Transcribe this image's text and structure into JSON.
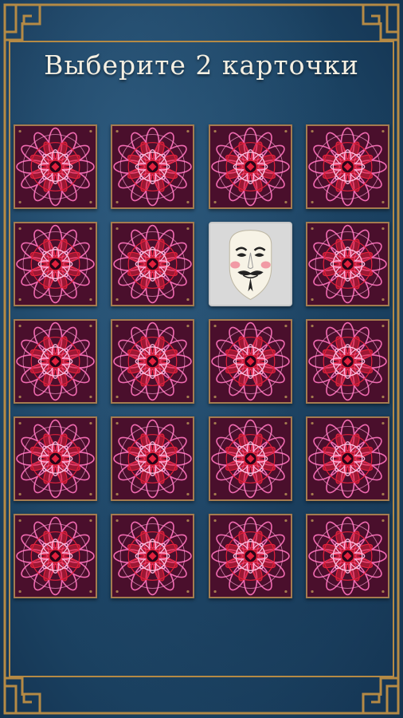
{
  "title": "Выберите 2 карточки",
  "colors": {
    "background": "#1d4666",
    "frame_gold": "#b58a45",
    "card_back": "#4a0f2c",
    "card_border": "#a57b4f",
    "pattern_pink": "#f06ab0",
    "pattern_red": "#e0203c",
    "revealed_bg": "#d9d9d9"
  },
  "board": {
    "rows": 5,
    "cols": 4,
    "cards": [
      {
        "state": "hidden"
      },
      {
        "state": "hidden"
      },
      {
        "state": "hidden"
      },
      {
        "state": "hidden"
      },
      {
        "state": "hidden"
      },
      {
        "state": "hidden"
      },
      {
        "state": "revealed",
        "face": "guy-fawkes-mask-icon"
      },
      {
        "state": "hidden"
      },
      {
        "state": "hidden"
      },
      {
        "state": "hidden"
      },
      {
        "state": "hidden"
      },
      {
        "state": "hidden"
      },
      {
        "state": "hidden"
      },
      {
        "state": "hidden"
      },
      {
        "state": "hidden"
      },
      {
        "state": "hidden"
      },
      {
        "state": "hidden"
      },
      {
        "state": "hidden"
      },
      {
        "state": "hidden"
      },
      {
        "state": "hidden"
      }
    ]
  }
}
